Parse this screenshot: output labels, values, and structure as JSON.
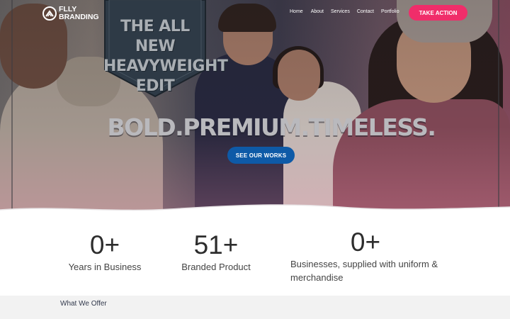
{
  "brand": {
    "name_line1": "FLLY",
    "name_line2": "BRANDING"
  },
  "nav": {
    "items": [
      "Home",
      "About",
      "Services",
      "Contact",
      "Portfolio"
    ],
    "cta_label": "TAKE ACTION"
  },
  "hero": {
    "badge_lines": [
      "THE ALL NEW",
      "HEAVYWEIGHT",
      "EDIT"
    ],
    "tagline": "BOLD.PREMIUM.TIMELESS.",
    "button_label": "SEE OUR WORKS"
  },
  "stats": [
    {
      "value": "0+",
      "label": "Years in Business"
    },
    {
      "value": "51+",
      "label": "Branded Product"
    },
    {
      "value": "0+",
      "label": "Businesses, supplied with uniform & merchandise"
    }
  ],
  "offer": {
    "title": "What We Offer"
  },
  "colors": {
    "cta_pink": "#f02d6a",
    "button_blue": "#0e5aa7",
    "badge_dark": "#2e3a46"
  }
}
